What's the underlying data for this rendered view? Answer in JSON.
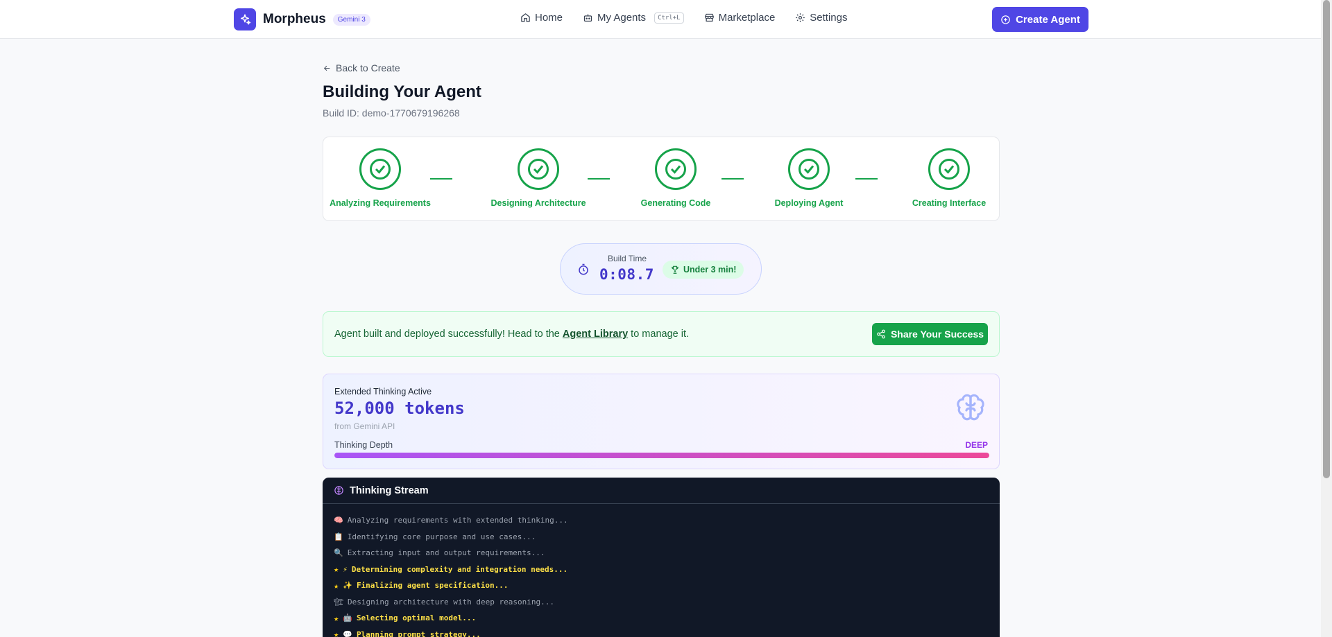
{
  "app": {
    "brand": "Morpheus",
    "model_badge": "Gemini 3"
  },
  "nav": {
    "home": "Home",
    "my_agents": "My Agents",
    "my_agents_shortcut": "Ctrl+L",
    "marketplace": "Marketplace",
    "settings": "Settings",
    "create_agent": "Create Agent"
  },
  "header": {
    "back_link": "Back to Create",
    "title": "Building Your Agent",
    "build_id": "Build ID: demo-1770679196268"
  },
  "steps": [
    {
      "label": "Analyzing Requirements",
      "status": "complete"
    },
    {
      "label": "Designing Architecture",
      "status": "complete"
    },
    {
      "label": "Generating Code",
      "status": "complete"
    },
    {
      "label": "Deploying Agent",
      "status": "complete"
    },
    {
      "label": "Creating Interface",
      "status": "complete"
    }
  ],
  "build_time": {
    "label": "Build Time",
    "value": "0:08.7",
    "award": "Under 3 min!"
  },
  "success": {
    "text_before": "Agent built and deployed successfully! Head to the ",
    "link": "Agent Library",
    "text_after": " to manage it.",
    "share_button": "Share Your Success"
  },
  "thinking": {
    "label": "Extended Thinking Active",
    "tokens": "52,000 tokens",
    "source": "from Gemini API",
    "depth_label": "Thinking Depth",
    "depth_value": "DEEP",
    "depth_fraction": 1.0
  },
  "stream": {
    "title": "Thinking Stream",
    "lines": [
      {
        "emoji": "🧠",
        "text": "Analyzing requirements with extended thinking...",
        "highlight": false
      },
      {
        "emoji": "📋",
        "text": "Identifying core purpose and use cases...",
        "highlight": false
      },
      {
        "emoji": "🔍",
        "text": "Extracting input and output requirements...",
        "highlight": false
      },
      {
        "emoji": "⚡",
        "text": "Determining complexity and integration needs...",
        "highlight": true
      },
      {
        "emoji": "✨",
        "text": "Finalizing agent specification...",
        "highlight": true
      },
      {
        "emoji": "🏗",
        "text": "Designing architecture with deep reasoning...",
        "highlight": false
      },
      {
        "emoji": "🤖",
        "text": "Selecting optimal model...",
        "highlight": true
      },
      {
        "emoji": "💬",
        "text": "Planning prompt strategy...",
        "highlight": true
      }
    ]
  },
  "colors": {
    "accent": "#4f46e5",
    "success": "#16a34a",
    "stream_bg": "#111827",
    "highlight": "#fde047"
  }
}
